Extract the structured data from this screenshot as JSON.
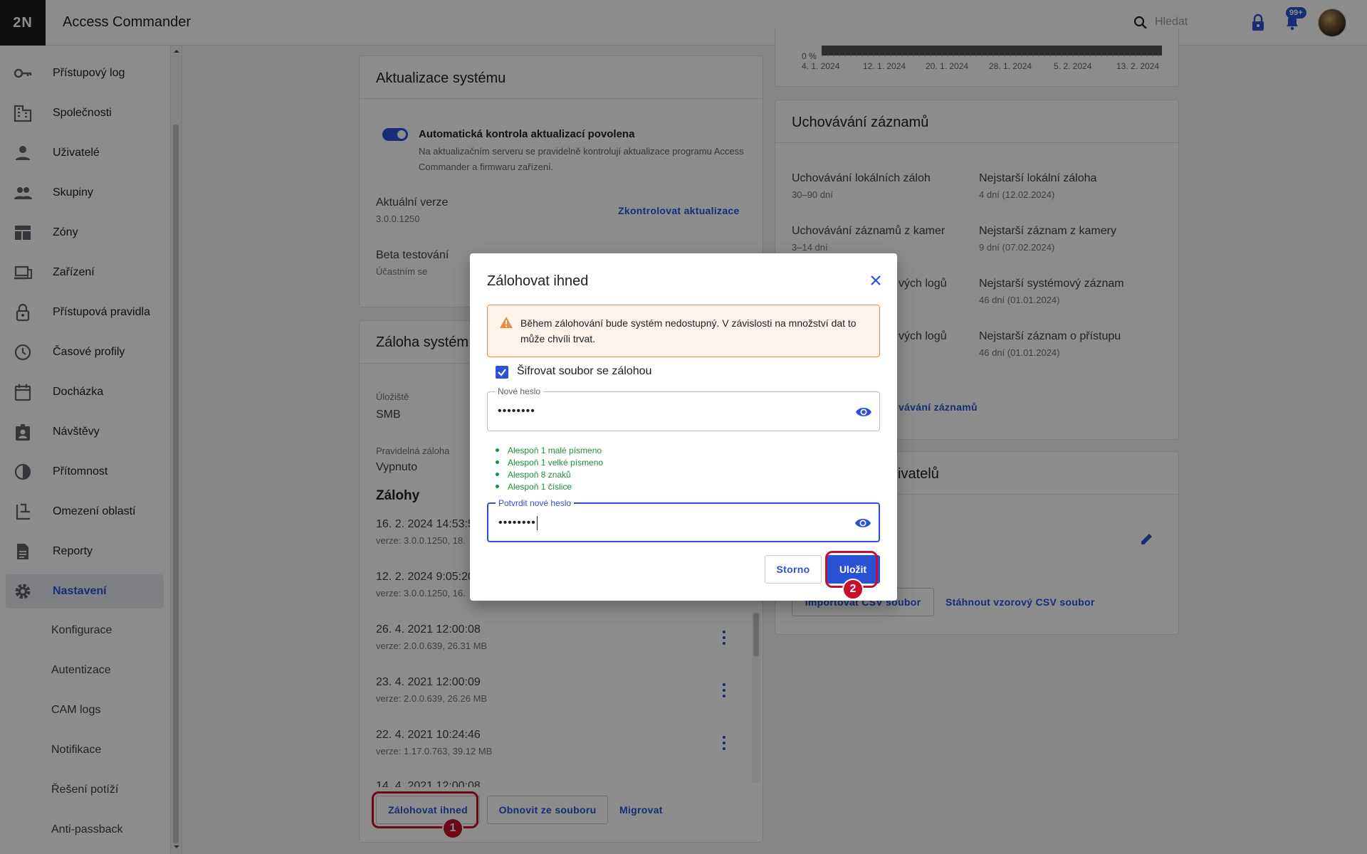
{
  "header": {
    "logo": "2N",
    "app_title": "Access Commander",
    "search_placeholder": "Hledat",
    "notifications_badge": "99+"
  },
  "sidebar": {
    "items": [
      {
        "label": "Přístupový log",
        "icon": "key-icon"
      },
      {
        "label": "Společnosti",
        "icon": "building-icon"
      },
      {
        "label": "Uživatelé",
        "icon": "person-icon"
      },
      {
        "label": "Skupiny",
        "icon": "group-icon"
      },
      {
        "label": "Zóny",
        "icon": "dashboard-icon"
      },
      {
        "label": "Zařízení",
        "icon": "devices-icon"
      },
      {
        "label": "Přístupová pravidla",
        "icon": "lock-icon"
      },
      {
        "label": "Časové profily",
        "icon": "clock-icon"
      },
      {
        "label": "Docházka",
        "icon": "calendar-icon"
      },
      {
        "label": "Návštěvy",
        "icon": "badge-icon"
      },
      {
        "label": "Přítomnost",
        "icon": "presence-icon"
      },
      {
        "label": "Omezení oblastí",
        "icon": "area-icon"
      },
      {
        "label": "Reporty",
        "icon": "document-icon"
      },
      {
        "label": "Nastavení",
        "icon": "gear-icon"
      }
    ],
    "sub_items": [
      "Konfigurace",
      "Autentizace",
      "CAM logs",
      "Notifikace",
      "Řešení potíží",
      "Anti-passback"
    ]
  },
  "chart": {
    "y_label": "0 %",
    "x_ticks": [
      "4. 1. 2024",
      "12. 1. 2024",
      "20. 1. 2024",
      "28. 1. 2024",
      "5. 2. 2024",
      "13. 2. 2024"
    ]
  },
  "update_card": {
    "title": "Aktualizace systému",
    "toggle_title": "Automatická kontrola aktualizací povolena",
    "toggle_desc": "Na aktualizačním serveru se pravidelně kontrolují aktualizace programu Access Commander a firmwaru zařízení.",
    "current_version_label": "Aktuální verze",
    "current_version": "3.0.0.1250",
    "check_updates": "Zkontrolovat aktualizace",
    "beta_label": "Beta testování",
    "beta_value": "Účastním se"
  },
  "backup_card": {
    "title": "Záloha systém",
    "storage_label": "Úložiště",
    "storage_value": "SMB",
    "schedule_label": "Pravidelná záloha",
    "schedule_value": "Vypnuto",
    "backups_title": "Zálohy",
    "backups": [
      {
        "date": "16. 2. 2024 14:53:5",
        "meta": "verze: 3.0.0.1250, 18."
      },
      {
        "date": "12. 2. 2024 9:05:20",
        "meta": "verze: 3.0.0.1250, 16."
      },
      {
        "date": "26. 4. 2021 12:00:08",
        "meta": "verze: 2.0.0.639, 26.31 MB"
      },
      {
        "date": "23. 4. 2021 12:00:09",
        "meta": "verze: 2.0.0.639, 26.26 MB"
      },
      {
        "date": "22. 4. 2021 10:24:46",
        "meta": "verze: 1.17.0.763, 39.12 MB"
      },
      {
        "date": "14. 4. 2021 12:00:08",
        "meta": ""
      }
    ],
    "backup_now": "Zálohovat ihned",
    "restore": "Obnovit ze souboru",
    "migrate": "Migrovat"
  },
  "retention_card": {
    "title": "Uchovávání záznamů",
    "items": [
      {
        "label": "Uchovávání lokálních záloh",
        "value": "30–90 dní"
      },
      {
        "label": "Nejstarší lokální záloha",
        "value": "4 dní (12.02.2024)"
      },
      {
        "label": "Uchovávání záznamů z kamer",
        "value": "3–14 dní"
      },
      {
        "label": "Nejstarší záznam z kamery",
        "value": "9 dní (07.02.2024)"
      },
      {
        "label": "vých logů",
        "value": ""
      },
      {
        "label": "Nejstarší systémový záznam",
        "value": "46 dní (01.01.2024)"
      },
      {
        "label": "vých logů",
        "value": ""
      },
      {
        "label": "Nejstarší záznam o přístupu",
        "value": "46 dní (01.01.2024)"
      }
    ],
    "link": "vávání záznamů"
  },
  "users_card": {
    "title": "živatelů",
    "import_csv": "Importovat CSV soubor",
    "download_csv": "Stáhnout vzorový CSV soubor"
  },
  "dialog": {
    "title": "Zálohovat ihned",
    "warning": "Během zálohování bude systém nedostupný. V závislosti na množství dat to může chvíli trvat.",
    "encrypt_label": "Šifrovat soubor se zálohou",
    "new_password_label": "Nové heslo",
    "new_password_value": "••••••••",
    "rules": [
      "Alespoň 1 malé písmeno",
      "Alespoň 1 velké písmeno",
      "Alespoň 8 znaků",
      "Alespoň 1 číslice"
    ],
    "confirm_password_label": "Potvrdit nové heslo",
    "confirm_password_value": "••••••••",
    "cancel": "Storno",
    "save": "Uložit"
  },
  "annotations": {
    "step1": "1",
    "step2": "2"
  },
  "colors": {
    "accent": "#2a52d6",
    "highlight": "#c8102e",
    "success": "#1e8e3e",
    "warning": "#f08a3c"
  }
}
